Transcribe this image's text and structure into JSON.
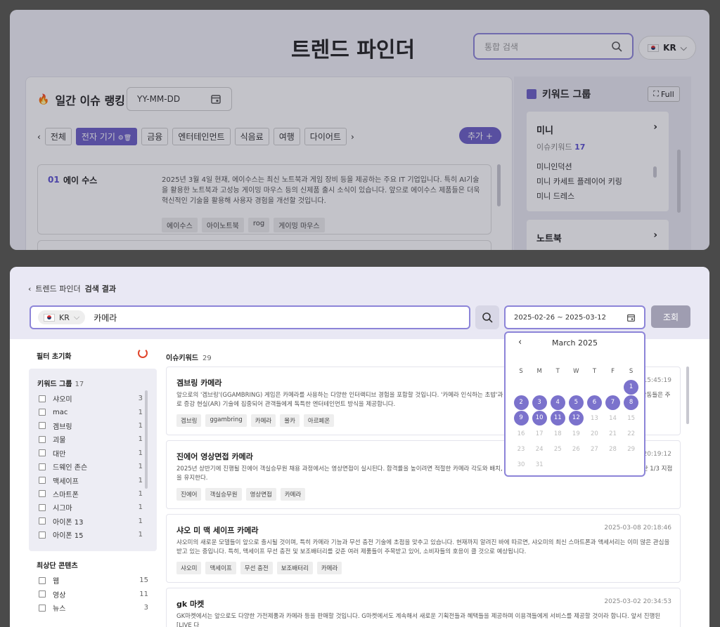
{
  "top": {
    "title": "트렌드 파인더",
    "search_placeholder": "통합 검색",
    "lang": "KR",
    "daily_rank_title": "일간 이슈 랭킹",
    "date_placeholder": "YY-MM-DD",
    "categories": [
      "전체",
      "전자 기기",
      "금융",
      "엔터테인먼트",
      "식음료",
      "여행",
      "다이어트"
    ],
    "active_category": "전자 기기",
    "add_label": "추가 +",
    "issue": {
      "num": "01",
      "name": "에이 수스",
      "desc": "2025년 3월 4일 현재, 에이수스는 최신 노트북과 게임 장비 등을 제공하는 주요 IT 기업입니다. 특히 AI기술을 활용한 노트북과 고성능 게이밍 마우스 등의 신제품 출시 소식이 있습니다. 앞으로 에이수스 제품들은 더욱 혁신적인 기술을 활용해 사용자 경험을 개선할 것입니다.",
      "tags": [
        "에이수스",
        "아이노트북",
        "rog",
        "게이밍 마우스"
      ]
    },
    "keyword_group_title": "키워드 그룹",
    "full_label": "Full",
    "kw_card": {
      "title": "미니",
      "sub_label": "이슈키워드",
      "sub_count": "17",
      "items": [
        "미니인덕션",
        "미니 카세트 플레이어 키링",
        "미니 드레스"
      ]
    },
    "kw_card2_title": "노트북"
  },
  "bottom": {
    "crumb_parent": "트렌드 파인더",
    "crumb_current": "검색 결과",
    "lang": "KR",
    "query": "카메라",
    "date_range": "2025-02-26 ~ 2025-03-12",
    "go_label": "조회",
    "filter_reset": "필터 초기화",
    "kw_group_label": "키워드 그룹",
    "kw_group_count": "17",
    "kw_filters": [
      {
        "name": "샤오미",
        "count": "3"
      },
      {
        "name": "mac",
        "count": "1"
      },
      {
        "name": "겜브링",
        "count": "1"
      },
      {
        "name": "괴물",
        "count": "1"
      },
      {
        "name": "대만",
        "count": "1"
      },
      {
        "name": "드웨인 존슨",
        "count": "1"
      },
      {
        "name": "맥세이프",
        "count": "1"
      },
      {
        "name": "스마트폰",
        "count": "1"
      },
      {
        "name": "시그마",
        "count": "1"
      },
      {
        "name": "아이폰 13",
        "count": "1"
      },
      {
        "name": "아이폰 15",
        "count": "1"
      }
    ],
    "top_content_label": "최상단 콘텐츠",
    "content_filters": [
      {
        "name": "웹",
        "count": "15"
      },
      {
        "name": "영상",
        "count": "11"
      },
      {
        "name": "뉴스",
        "count": "3"
      }
    ],
    "results_label": "이슈키워드",
    "results_count": "29",
    "results": [
      {
        "title": "겜브링 카메라",
        "time": "15:45:19",
        "desc": "앞으로의 '겜브링'(GGAMBRING) 게임은 카메라를 사용하는 다양한 인터랙티브 경험을 포함할 것입니다. '카메라 인식하는 초밥'과 사진이 사용자에게 새로운 재미를 선사할 것입니다. 이 활동들은 주로 증강 현실(AR) 기술에 집중되어 관객들에게 독특한 엔터테인먼트 방식을 제공합니다.",
        "tags": [
          "겜브링",
          "ggambring",
          "카메라",
          "몰카",
          "아르페온"
        ]
      },
      {
        "title": "진에어 영상면접 카메라",
        "time": "20:19:12",
        "desc": "2025년 상반기에 진행될 진에어 객실승무원 채용 과정에서는 영상면접이 실시된다. 합격률을 높이려면 적절한 카메라 각도와 배치, 그리고 조명이 에 꽉 차도록 설정하고, 눈높이는 화면 상단 1/3 지점을 유지한다.",
        "tags": [
          "진에어",
          "객실승무원",
          "영상면접",
          "카메라"
        ]
      },
      {
        "title": "샤오 미 맥 세이프 카메라",
        "time": "2025-03-08 20:18:46",
        "desc": "샤오미의 새로운 모델들이 앞으로 출시될 것이며, 특히 카메라 기능과 무선 충전 기술에 초점을 맞추고 있습니다. 현재까지 알려진 바에 따르면, 샤오미의 최신 스마트폰과 액세서리는 이미 많은 관심을 받고 있는 중입니다. 특히, 맥세이프 무선 충전 및 보조배터리를 갖춘 여러 제품들이 주목받고 있어, 소비자들의 호응이 클 것으로 예상됩니다.",
        "tags": [
          "샤오미",
          "맥세이프",
          "무선 충전",
          "보조배터리",
          "카메라"
        ]
      },
      {
        "title": "gk 마켓",
        "time": "2025-03-02 20:34:53",
        "desc": "GK마켓에서는 앞으로도 다양한 가전제품과 카메라 등을 판매할 것입니다. G마켓에서도 계속해서 새로운 기획전들과 혜택들을 제공하며 이용객들에게 서비스를 제공할 것이라 합니다. 앞서 진행된 [LIVE 다",
        "tags": []
      }
    ],
    "calendar": {
      "month_label": "March 2025",
      "dow": [
        "S",
        "M",
        "T",
        "W",
        "T",
        "F",
        "S"
      ],
      "weeks": [
        [
          "",
          "",
          "",
          "",
          "",
          "",
          "1"
        ],
        [
          "2",
          "3",
          "4",
          "5",
          "6",
          "7",
          "8"
        ],
        [
          "9",
          "10",
          "11",
          "12",
          "13",
          "14",
          "15"
        ],
        [
          "16",
          "17",
          "18",
          "19",
          "20",
          "21",
          "22"
        ],
        [
          "23",
          "24",
          "25",
          "26",
          "27",
          "28",
          "29"
        ],
        [
          "30",
          "31",
          "",
          "",
          "",
          "",
          ""
        ]
      ],
      "selected_through": 12
    }
  }
}
